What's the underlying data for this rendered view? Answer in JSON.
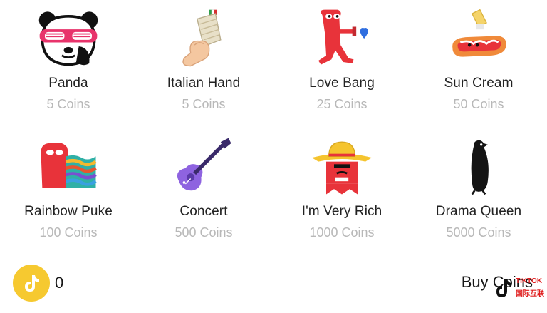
{
  "gifts": [
    {
      "name": "Panda",
      "price": "5 Coins",
      "icon": "panda-icon"
    },
    {
      "name": "Italian Hand",
      "price": "5 Coins",
      "icon": "italian-hand-icon"
    },
    {
      "name": "Love Bang",
      "price": "25 Coins",
      "icon": "love-bang-icon"
    },
    {
      "name": "Sun Cream",
      "price": "50 Coins",
      "icon": "sun-cream-icon"
    },
    {
      "name": "Rainbow Puke",
      "price": "100 Coins",
      "icon": "rainbow-puke-icon"
    },
    {
      "name": "Concert",
      "price": "500 Coins",
      "icon": "concert-guitar-icon"
    },
    {
      "name": "I'm Very Rich",
      "price": "1000 Coins",
      "icon": "very-rich-icon"
    },
    {
      "name": "Drama Queen",
      "price": "5000 Coins",
      "icon": "drama-queen-icon"
    }
  ],
  "footer": {
    "coin_icon": "tiktok-coin-icon",
    "balance": "0",
    "buy_label": "Buy Coins"
  },
  "watermark": {
    "line1": "TIKTOK",
    "line2": "国际互联"
  },
  "colors": {
    "name_text": "#222222",
    "price_text": "#b8b8b8",
    "coin_gold": "#f6c930",
    "watermark_red": "#e02020"
  }
}
